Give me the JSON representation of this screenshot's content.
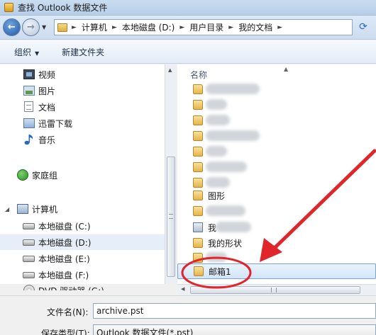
{
  "window": {
    "title": "查找 Outlook 数据文件"
  },
  "address": {
    "crumbs": [
      "计算机",
      "本地磁盘 (D:)",
      "用户目录",
      "我的文档"
    ]
  },
  "toolbar": {
    "organize": "组织",
    "new_folder": "新建文件夹"
  },
  "nav": {
    "libraries": [
      {
        "label": "视频",
        "icon": "video-icon"
      },
      {
        "label": "图片",
        "icon": "pictures-icon"
      },
      {
        "label": "文档",
        "icon": "documents-icon"
      },
      {
        "label": "迅雷下载",
        "icon": "xunlei-download-icon"
      },
      {
        "label": "音乐",
        "icon": "music-icon"
      }
    ],
    "homegroup": "家庭组",
    "computer": "计算机",
    "drives": [
      {
        "label": "本地磁盘 (C:)",
        "selected": false
      },
      {
        "label": "本地磁盘 (D:)",
        "selected": true
      },
      {
        "label": "本地磁盘 (E:)",
        "selected": false
      },
      {
        "label": "本地磁盘 (F:)",
        "selected": false
      },
      {
        "label": "DVD 驱动器 (G:)",
        "selected": false
      }
    ]
  },
  "files": {
    "column_name": "名称",
    "visible_names": {
      "graph": "图形",
      "partial": "我",
      "shapes": "我的形状",
      "mailbox": "邮箱1"
    }
  },
  "form": {
    "filename_label": "文件名(N):",
    "filename_value": "archive.pst",
    "filetype_label": "保存类型(T):",
    "filetype_value": "Outlook 数据文件(*.pst)"
  },
  "colors": {
    "annotation_red": "#e0262b",
    "selection_blue": "#7da2ce"
  }
}
